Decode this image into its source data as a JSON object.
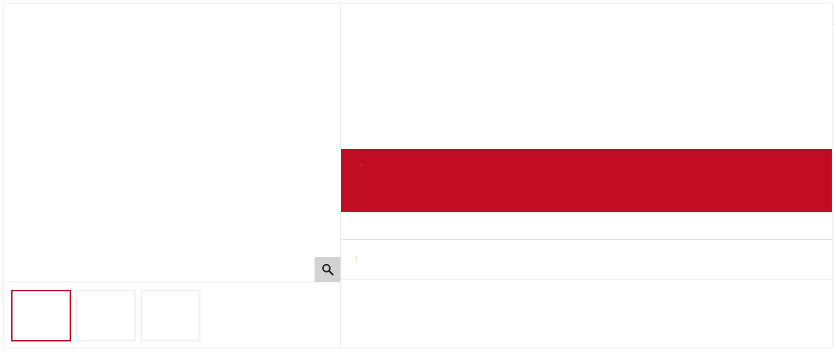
{
  "gallery": {
    "zoom_button": {
      "icon": "magnifier-icon",
      "background": "#d2d2d2"
    },
    "thumbnails": [
      {
        "selected": true
      },
      {
        "selected": false
      },
      {
        "selected": false
      }
    ]
  },
  "details": {
    "price_banner": {
      "color": "#c20c24"
    }
  },
  "theme": {
    "accent": "#c20c24",
    "border": "#e6e6e6"
  }
}
